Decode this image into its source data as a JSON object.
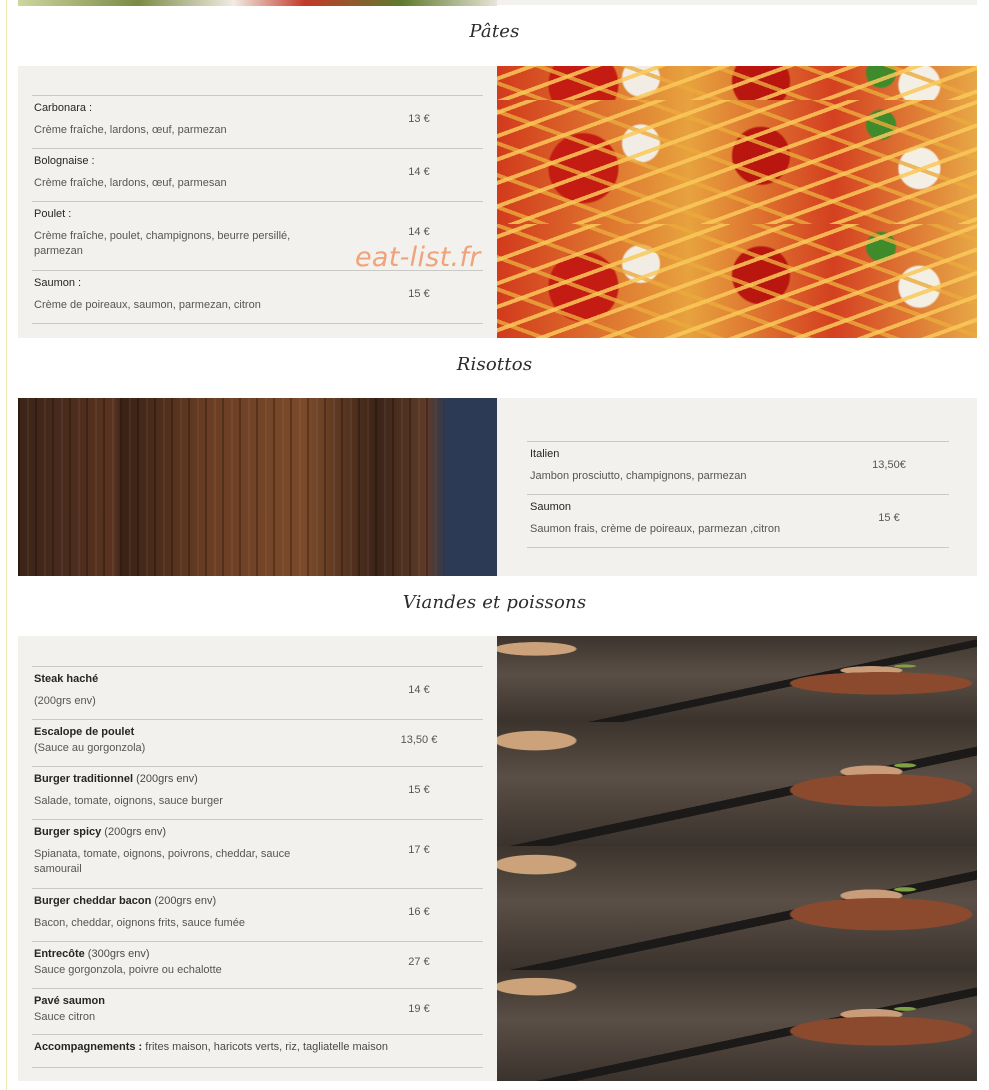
{
  "watermark": "eat-list.fr",
  "sections": {
    "pates": {
      "title": "Pâtes",
      "items": [
        {
          "name": "Carbonara :",
          "desc": "Crème fraîche, lardons, œuf, parmezan",
          "price": "13 €"
        },
        {
          "name": "Bolognaise :",
          "desc": "Crème fraîche, lardons, œuf, parmesan",
          "price": "14 €"
        },
        {
          "name": "Poulet :",
          "desc": "Crème fraîche, poulet, champignons, beurre persillé, parmezan",
          "price": "14 €"
        },
        {
          "name": "Saumon :",
          "desc": "Crème de poireaux, saumon, parmezan, citron",
          "price": "15 €"
        }
      ]
    },
    "risottos": {
      "title": "Risottos",
      "items": [
        {
          "name": "Italien",
          "desc": "Jambon prosciutto, champignons, parmezan",
          "price": "13,50€"
        },
        {
          "name": "Saumon",
          "desc": "Saumon frais, crème de poireaux, parmezan ,citron",
          "price": "15 €"
        }
      ]
    },
    "viandes": {
      "title": "Viandes et poissons",
      "items": [
        {
          "name": "Steak haché",
          "extra": "",
          "desc": "(200grs env)",
          "price": "14 €"
        },
        {
          "name": "Escalope de poulet",
          "extra": "",
          "desc": "(Sauce au gorgonzola)",
          "price": "13,50 €"
        },
        {
          "name": "Burger traditionnel",
          "extra": " (200grs env)",
          "desc": "Salade, tomate, oignons, sauce burger",
          "price": "15 €"
        },
        {
          "name": "Burger spicy",
          "extra": " (200grs env)",
          "desc": "Spianata, tomate, oignons, poivrons, cheddar,  sauce samourail",
          "price": "17 €"
        },
        {
          "name": "Burger cheddar bacon",
          "extra": " (200grs env)",
          "desc": "Bacon, cheddar, oignons frits, sauce fumée",
          "price": "16 €"
        },
        {
          "name": "Entrecôte",
          "extra": " (300grs env)",
          "desc": "Sauce gorgonzola, poivre ou echalotte",
          "price": "27 €"
        },
        {
          "name": "Pavé saumon",
          "extra": "",
          "desc": "Sauce citron",
          "price": "19 €"
        }
      ],
      "accompagnements_label": "Accompagnements :",
      "accompagnements_text": " frites maison, haricots verts, riz, tagliatelle maison"
    }
  }
}
